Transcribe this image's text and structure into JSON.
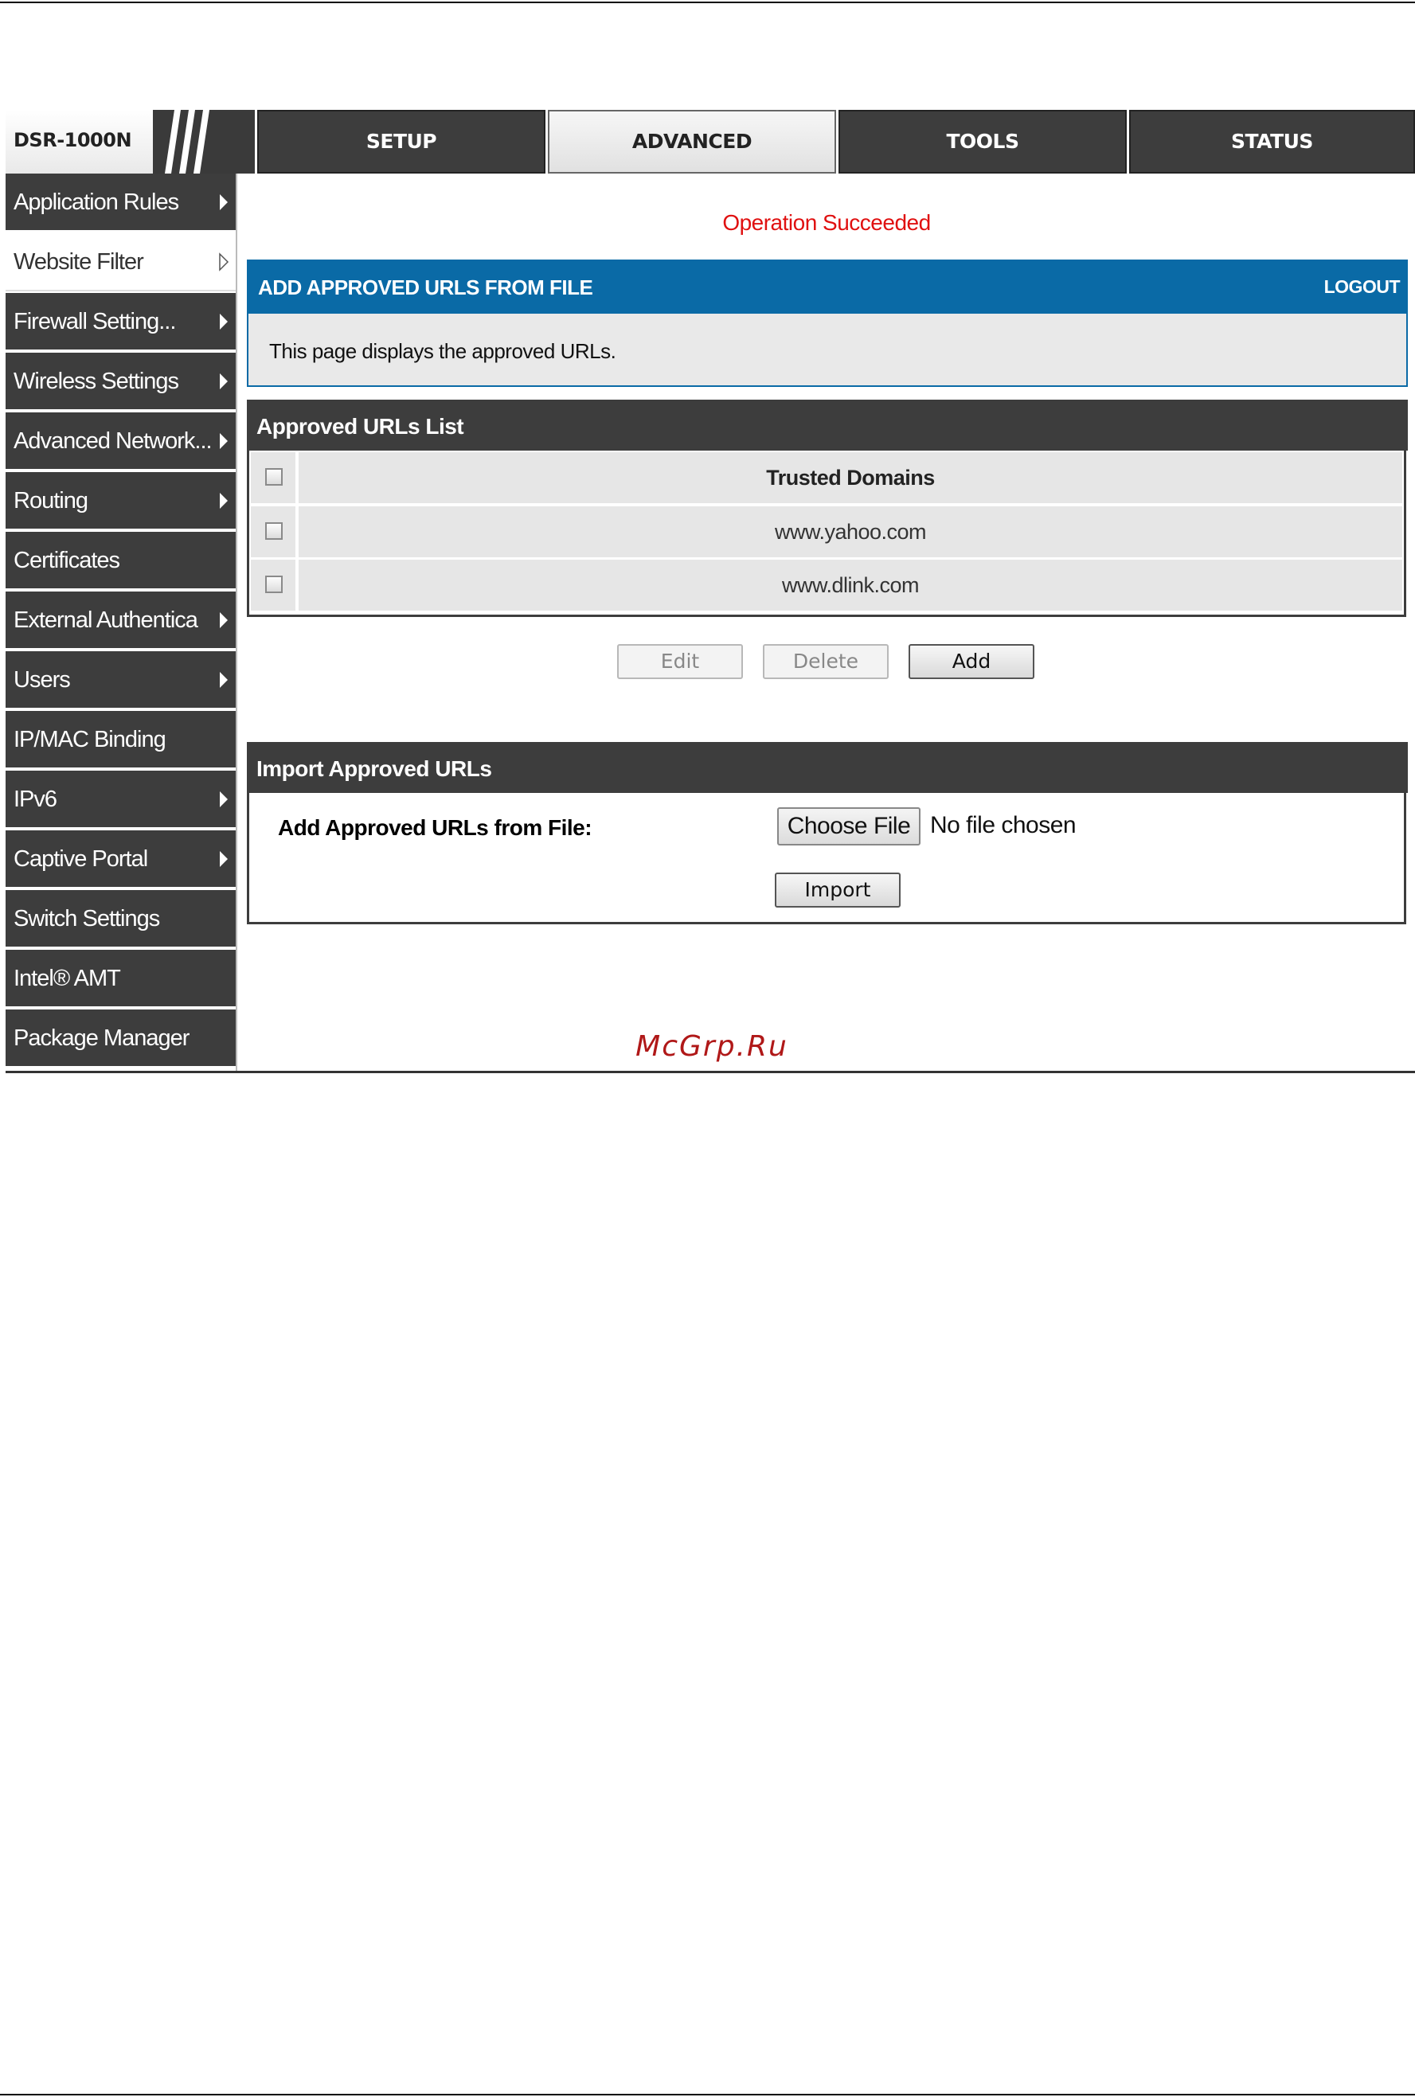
{
  "brand": {
    "label": "DSR-1000N"
  },
  "nav": {
    "tabs": [
      {
        "label": "SETUP",
        "active": false
      },
      {
        "label": "ADVANCED",
        "active": true
      },
      {
        "label": "TOOLS",
        "active": false
      },
      {
        "label": "STATUS",
        "active": false
      }
    ]
  },
  "sidebar": {
    "items": [
      {
        "label": "Application Rules",
        "arrow": "filled"
      },
      {
        "label": "Website Filter",
        "arrow": "outline",
        "active": true
      },
      {
        "label": "Firewall Setting...",
        "arrow": "filled"
      },
      {
        "label": "Wireless Settings",
        "arrow": "filled"
      },
      {
        "label": "Advanced Network...",
        "arrow": "filled"
      },
      {
        "label": "Routing",
        "arrow": "filled"
      },
      {
        "label": "Certificates",
        "arrow": "none"
      },
      {
        "label": "External Authentica",
        "arrow": "filled"
      },
      {
        "label": "Users",
        "arrow": "filled"
      },
      {
        "label": "IP/MAC Binding",
        "arrow": "none"
      },
      {
        "label": "IPv6",
        "arrow": "filled"
      },
      {
        "label": "Captive Portal",
        "arrow": "filled"
      },
      {
        "label": "Switch Settings",
        "arrow": "none"
      },
      {
        "label": "Intel® AMT",
        "arrow": "none"
      },
      {
        "label": "Package Manager",
        "arrow": "none"
      }
    ]
  },
  "status": {
    "message": "Operation Succeeded",
    "color": "#e01010"
  },
  "page": {
    "title": "ADD APPROVED URLS FROM FILE",
    "logout": "LOGOUT",
    "description": "This page displays the approved URLs."
  },
  "list": {
    "title": "Approved URLs List",
    "column_header": "Trusted Domains",
    "rows": [
      "www.yahoo.com",
      "www.dlink.com"
    ],
    "buttons": {
      "edit": "Edit",
      "delete": "Delete",
      "add": "Add"
    }
  },
  "import": {
    "title": "Import Approved URLs",
    "field_label": "Add Approved URLs from File:",
    "choose_label": "Choose File",
    "no_file": "No file chosen",
    "import_button": "Import"
  },
  "watermark": "McGrp.Ru",
  "colors": {
    "header_blue": "#0a6aa6",
    "dark": "#3d3d3d"
  }
}
